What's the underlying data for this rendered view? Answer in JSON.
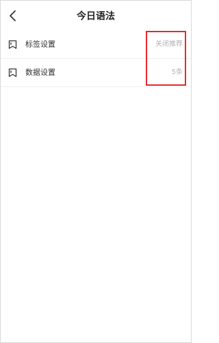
{
  "header": {
    "title": "今日语法",
    "back_icon": "chevron-left-icon"
  },
  "settings": [
    {
      "label": "标签设置",
      "value": "关闭推荐",
      "icon": "bookmark-icon"
    },
    {
      "label": "数据设置",
      "value": "5条",
      "icon": "bookmark-icon"
    }
  ],
  "colors": {
    "highlight": "#e8262b",
    "value_text": "#b3b3b3"
  }
}
